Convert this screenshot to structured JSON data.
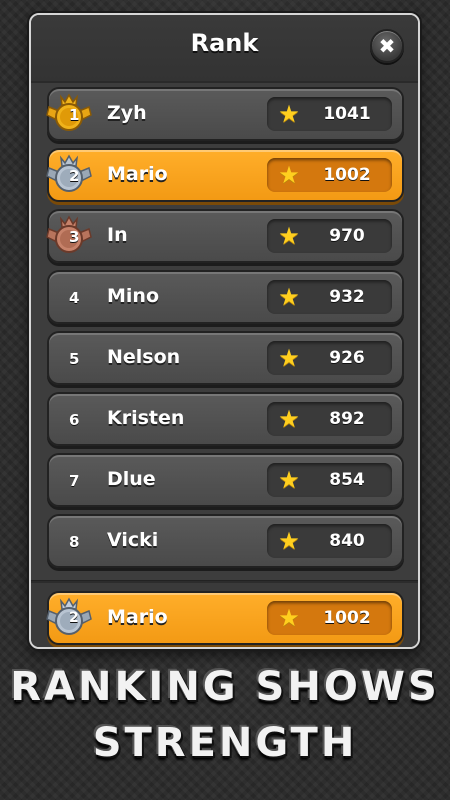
{
  "title": "Rank",
  "close_label": "✖",
  "star_glyph": "★",
  "colors": {
    "accent_orange": "#f7a31c",
    "gold_medal": "#f0b21a",
    "silver_medal": "#b8c4d2",
    "bronze_medal": "#c7826a",
    "star": "#ffcf1f"
  },
  "rows": [
    {
      "rank": "1",
      "name": "Zyh",
      "score": "1041",
      "medal": "gold"
    },
    {
      "rank": "2",
      "name": "Mario",
      "score": "1002",
      "medal": "silver",
      "is_me": true
    },
    {
      "rank": "3",
      "name": "In",
      "score": "970",
      "medal": "bronze"
    },
    {
      "rank": "4",
      "name": "Mino",
      "score": "932"
    },
    {
      "rank": "5",
      "name": "Nelson",
      "score": "926"
    },
    {
      "rank": "6",
      "name": "Kristen",
      "score": "892"
    },
    {
      "rank": "7",
      "name": "Dlue",
      "score": "854"
    },
    {
      "rank": "8",
      "name": "Vicki",
      "score": "840"
    }
  ],
  "me": {
    "rank": "2",
    "name": "Mario",
    "score": "1002",
    "medal": "silver"
  },
  "slogan": {
    "line1": "RANKING SHOWS",
    "line2": "STRENGTH"
  }
}
